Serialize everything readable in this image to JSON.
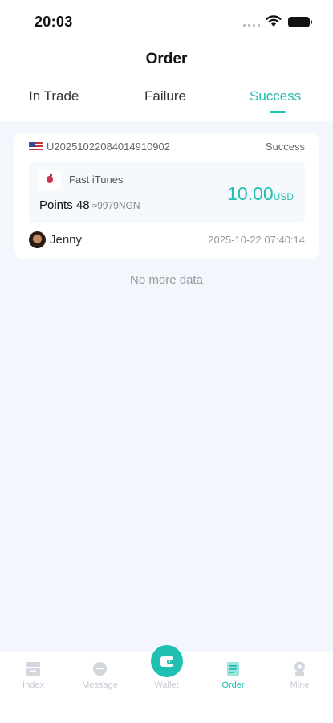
{
  "status_bar": {
    "time": "20:03"
  },
  "header": {
    "title": "Order"
  },
  "tabs": [
    {
      "label": "In Trade",
      "active": false
    },
    {
      "label": "Failure",
      "active": false
    },
    {
      "label": "Success",
      "active": true
    }
  ],
  "orders": [
    {
      "flag_icon": "us-flag-icon",
      "order_no": "U20251022084014910902",
      "status": "Success",
      "product_icon": "apple-icon",
      "product_name": "Fast iTunes",
      "points_label": "Points 48",
      "points_equiv": "≈9979NGN",
      "amount": "10.00",
      "currency": "USD",
      "user_name": "Jenny",
      "date": "2025-10-22 07:40:14"
    }
  ],
  "list_footer": "No more data",
  "tab_bar": {
    "items": [
      {
        "label": "Index",
        "icon": "index-icon"
      },
      {
        "label": "Message",
        "icon": "message-icon"
      },
      {
        "label": "Wallet",
        "icon": "wallet-icon"
      },
      {
        "label": "Order",
        "icon": "order-icon",
        "active": true
      },
      {
        "label": "Mine",
        "icon": "mine-icon"
      }
    ]
  },
  "colors": {
    "accent": "#1fbfb2",
    "background": "#f3f6fd",
    "inactive": "#c8ccd4"
  }
}
